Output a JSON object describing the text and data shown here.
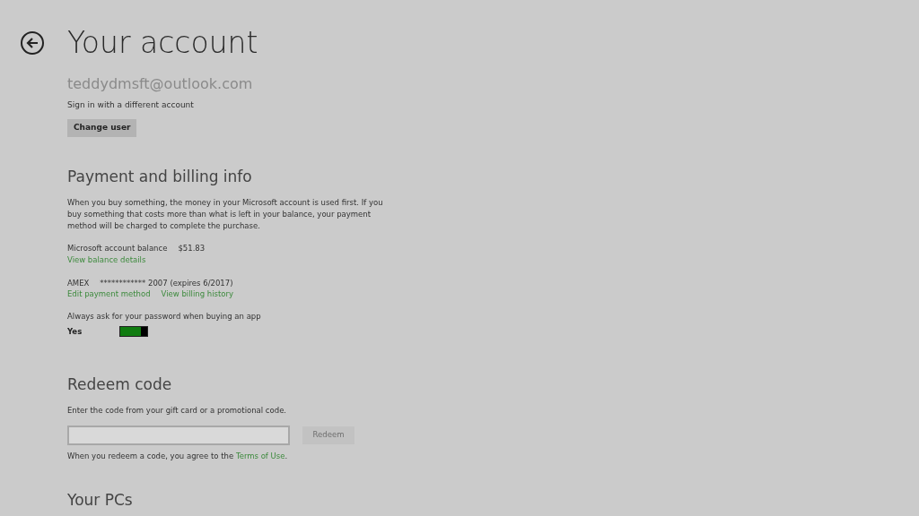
{
  "header": {
    "title": "Your account"
  },
  "account": {
    "email": "teddydmsft@outlook.com",
    "hint": "Sign in with a different account",
    "button": "Change user"
  },
  "payment": {
    "heading": "Payment and billing info",
    "description": "When you buy something, the money in your Microsoft account is used first. If you buy something that costs more than what is left in your balance, your payment method will be charged to complete the purchase.",
    "balance_label": "Microsoft account balance",
    "balance_value": "$51.83",
    "balance_link": "View balance details",
    "card_type": "AMEX",
    "card_number": "************ 2007 (expires 6/2017)",
    "card_links": [
      "Edit payment method",
      "View billing history"
    ],
    "password_prompt": "Always ask for your password when buying an app",
    "toggle": {
      "label": "Yes",
      "on": true
    }
  },
  "redeem": {
    "heading": "Redeem code",
    "description": "Enter the code from your gift card or a promotional code.",
    "button": {
      "label": "Redeem",
      "disabled": true
    },
    "terms_before": "When you redeem a code, you agree to the ",
    "terms_link": "Terms of Use",
    "terms_after": "."
  },
  "pcs": {
    "heading": "Your PCs"
  }
}
